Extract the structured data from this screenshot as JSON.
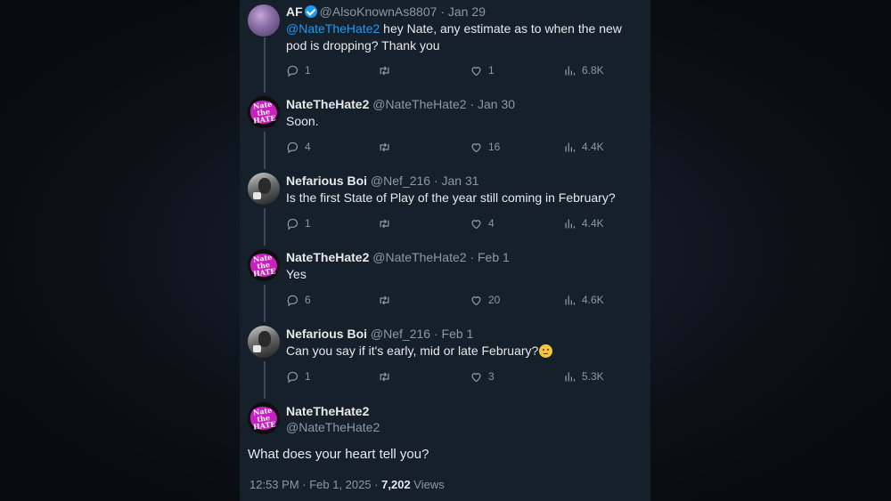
{
  "thread": [
    {
      "name": "AF",
      "verified": true,
      "handle": "@AlsoKnownAs8807",
      "sep": "·",
      "date": "Jan 29",
      "mention": "@NateTheHate2",
      "text": " hey Nate, any estimate as to when the new pod is dropping? Thank you",
      "replies": "1",
      "retweets": "",
      "likes": "1",
      "views": "6.8K"
    },
    {
      "name": "NateTheHate2",
      "handle": "@NateTheHate2",
      "sep": "·",
      "date": "Jan 30",
      "text": "Soon.",
      "replies": "4",
      "retweets": "",
      "likes": "16",
      "views": "4.4K"
    },
    {
      "name": "Nefarious Boi",
      "handle": "@Nef_216",
      "sep": "·",
      "date": "Jan 31",
      "text": "Is the first State of Play of the year still coming in February?",
      "replies": "1",
      "retweets": "",
      "likes": "4",
      "views": "4.4K"
    },
    {
      "name": "NateTheHate2",
      "handle": "@NateTheHate2",
      "sep": "·",
      "date": "Feb 1",
      "text": "Yes",
      "replies": "6",
      "retweets": "",
      "likes": "20",
      "views": "4.6K"
    },
    {
      "name": "Nefarious Boi",
      "handle": "@Nef_216",
      "sep": "·",
      "date": "Feb 1",
      "text": "Can you say if it's early, mid or late February?",
      "emoji": "thinking-face-emoji",
      "replies": "1",
      "retweets": "",
      "likes": "3",
      "views": "5.3K"
    }
  ],
  "main": {
    "name": "NateTheHate2",
    "handle": "@NateTheHate2",
    "text": "What does your heart tell you?",
    "time": "12:53 PM · Feb 1, 2025 · ",
    "views_count": "7,202",
    "views_label": " Views"
  },
  "avatar_text": "Nate\nthe\nHATE",
  "colors": {
    "panel": "#15202b",
    "accent": "#1d9bf0",
    "muted": "#8b98a5",
    "text": "#e7e9ea"
  },
  "icons": [
    "reply-icon",
    "retweet-icon",
    "like-icon",
    "views-icon",
    "verified-badge-icon"
  ]
}
